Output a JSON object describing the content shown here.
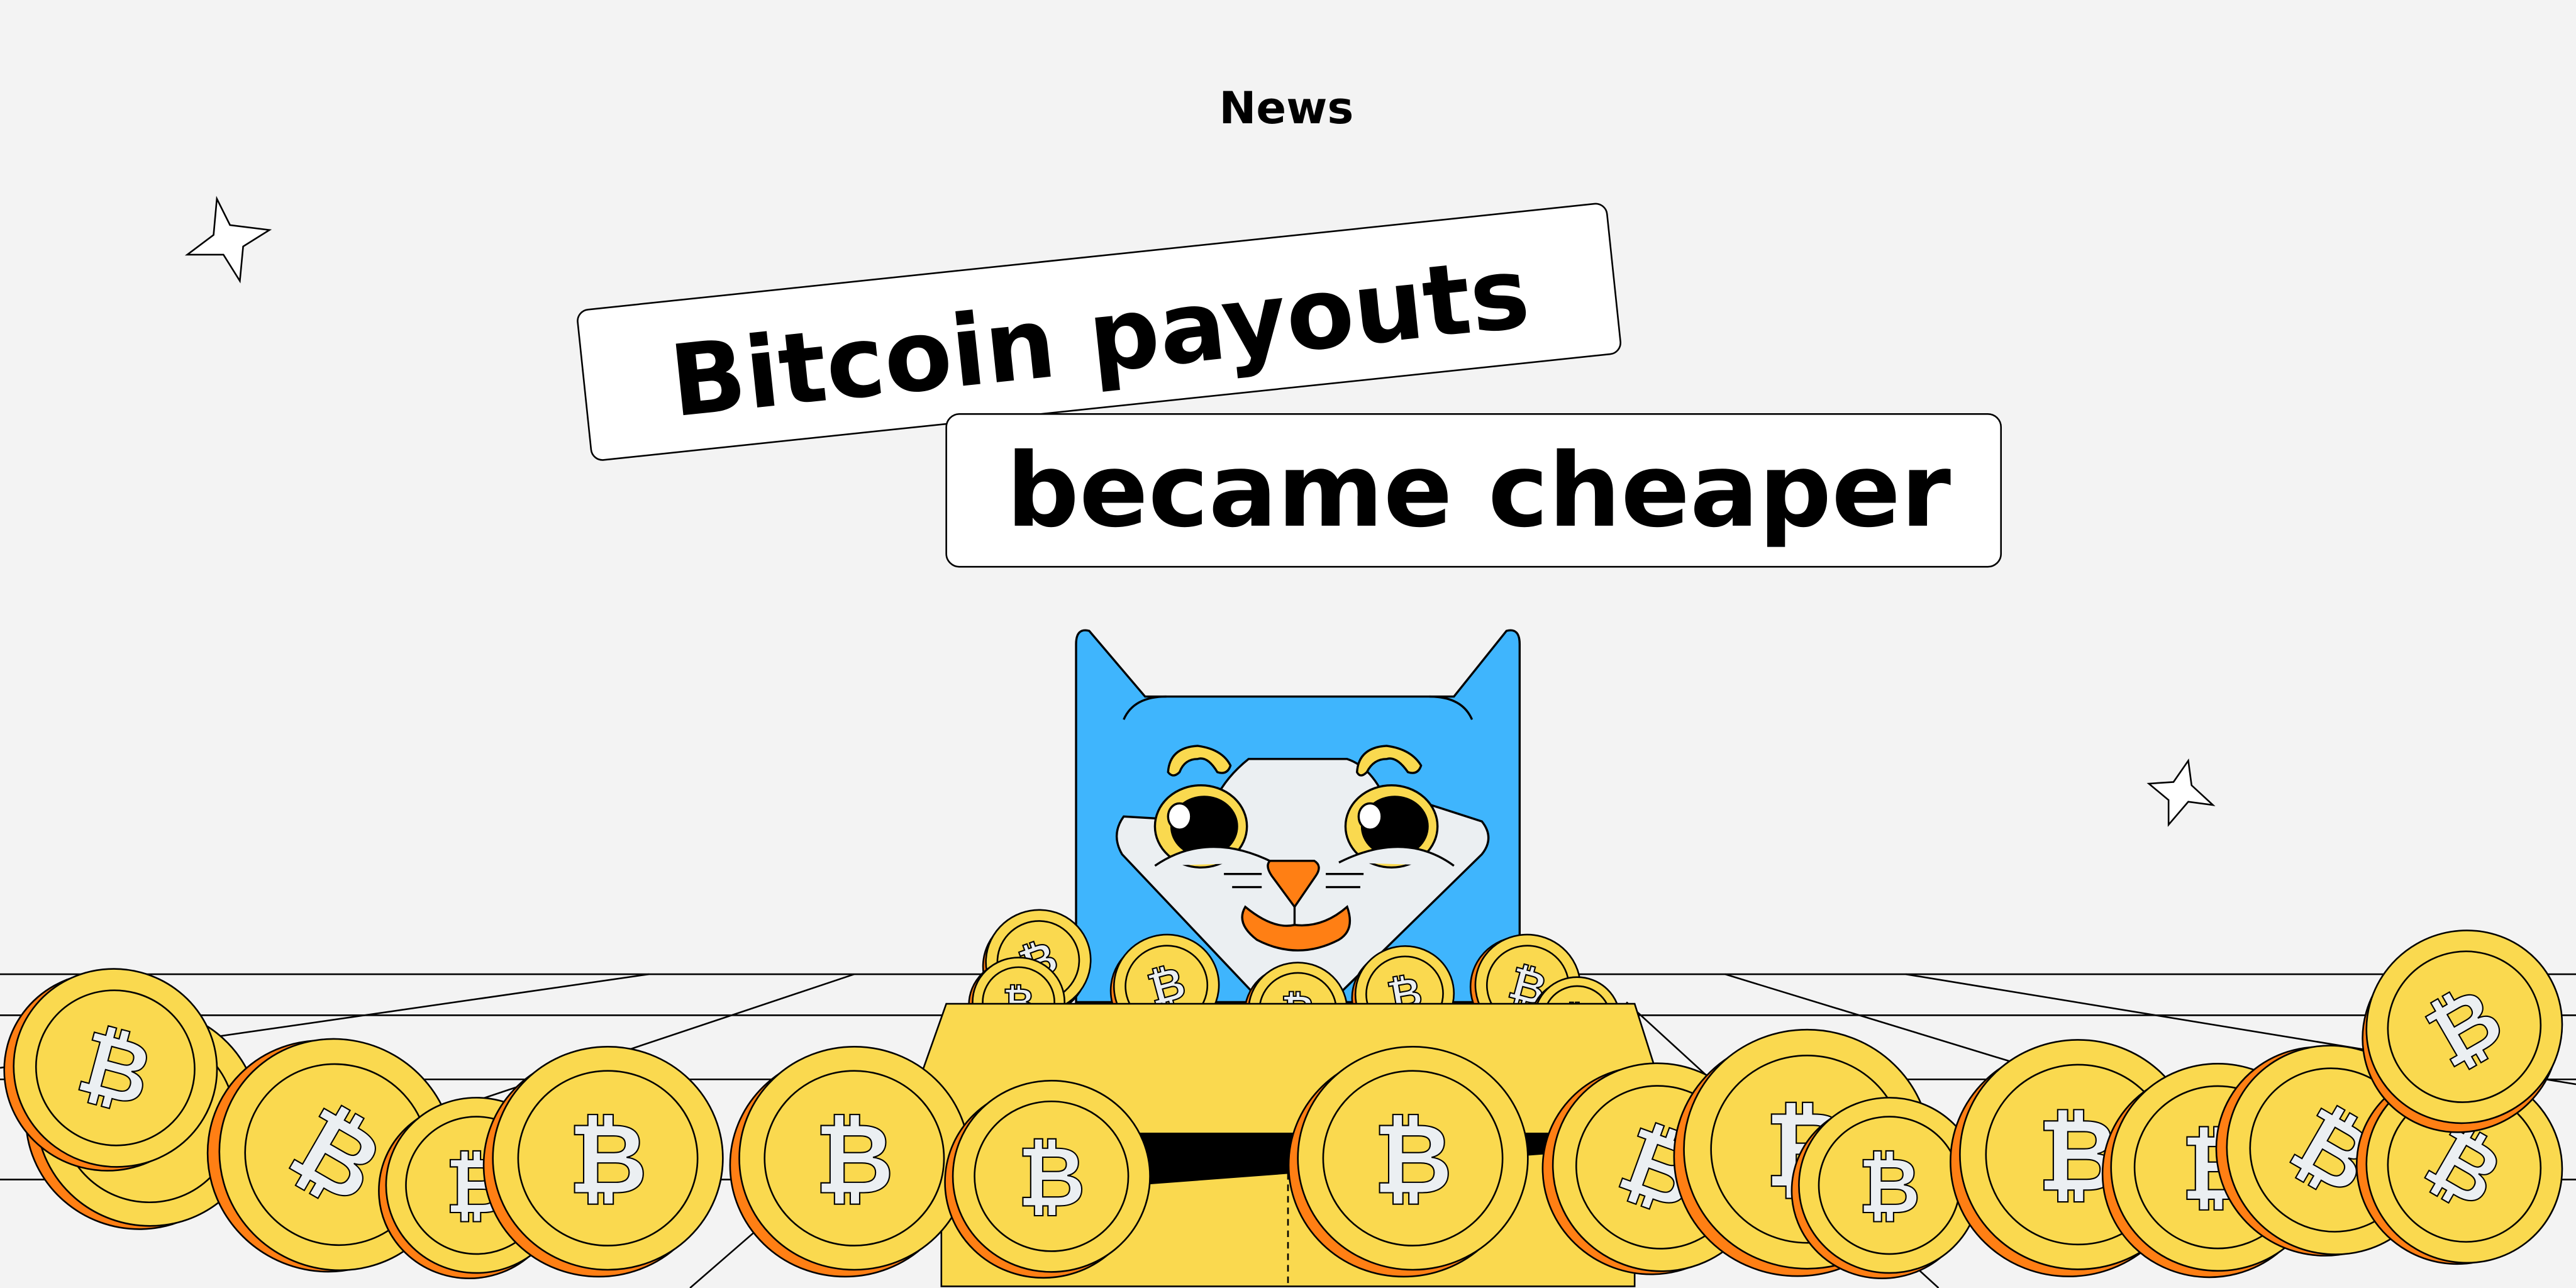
{
  "header": {
    "section_label": "News"
  },
  "headline": {
    "line1": "Bitcoin payouts",
    "line2": "became cheaper"
  },
  "illustration": {
    "subject": "cat in a box full of bitcoin coins",
    "coin_symbol": "₿",
    "icons": [
      "sparkle-star-icon",
      "bitcoin-coin-icon"
    ]
  },
  "colors": {
    "background": "#f3f3f3",
    "cat_blue": "#3fb5fd",
    "coin_yellow": "#fad94f",
    "accent_orange": "#ff7f14",
    "face": "#ebeff2"
  }
}
